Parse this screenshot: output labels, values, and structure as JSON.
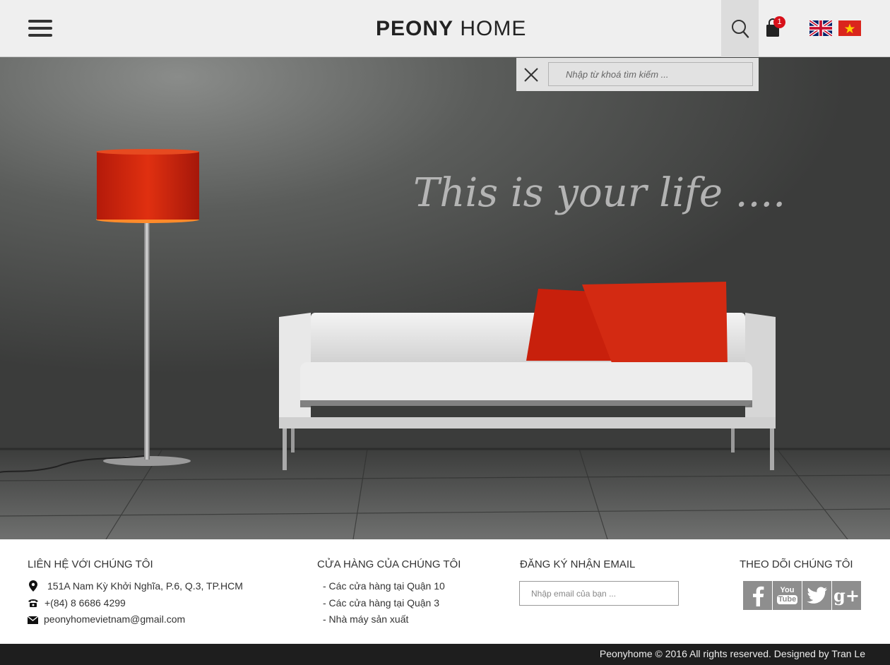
{
  "header": {
    "logo_bold": "PEONY",
    "logo_light": "HOME",
    "cart_count": "1"
  },
  "search": {
    "placeholder": "Nhập từ khoá tìm kiếm ..."
  },
  "hero": {
    "tagline": "This is your life ...."
  },
  "footer": {
    "contact": {
      "title": "LIÊN HỆ VỚI CHÚNG TÔI",
      "address": "151A Nam Kỳ Khởi Nghĩa, P.6, Q.3, TP.HCM",
      "phone": "+(84) 8 6686 4299",
      "email": "peonyhomevietnam@gmail.com"
    },
    "stores": {
      "title": "CỬA HÀNG CỦA CHÚNG TÔI",
      "items": [
        "- Các cửa hàng tại Quận 10",
        "- Các cửa hàng tại Quận 3",
        "- Nhà máy sản xuất"
      ]
    },
    "newsletter": {
      "title": "ĐĂNG KÝ NHẬN EMAIL",
      "placeholder": "Nhập email của bạn ..."
    },
    "follow": {
      "title": "THEO DÕI CHÚNG TÔI",
      "youtube_you": "You",
      "youtube_tube": "Tube",
      "gplus": "g+"
    }
  },
  "copyright": "Peonyhome © 2016 All rights reserved. Designed by Tran Le",
  "colors": {
    "accent_red": "#d82a10",
    "badge_red": "#d8101a",
    "header_bg": "#efefef",
    "footer_bar": "#1e1e1e",
    "social_gray": "#8e8e8e"
  }
}
